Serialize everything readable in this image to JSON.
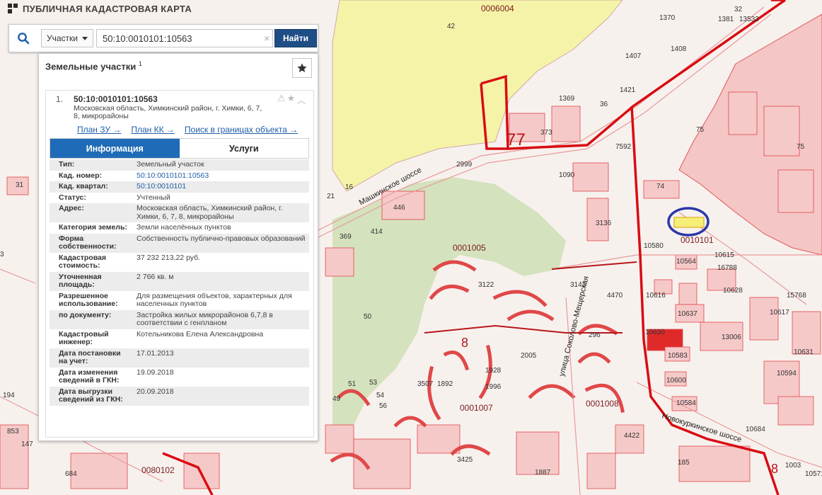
{
  "app": {
    "title": "ПУБЛИЧНАЯ КАДАСТРОВАЯ КАРТА"
  },
  "search": {
    "type_label": "Участки",
    "query": "50:10:0010101:10563",
    "clear_symbol": "×",
    "button_label": "Найти"
  },
  "panel": {
    "title": "Земельные участки",
    "count": "1",
    "result": {
      "number": "1.",
      "cad_number": "50:10:0010101:10563",
      "address": "Московская область, Химкинский район, г. Химки, 6, 7, 8, микрорайоны",
      "links": [
        "План ЗУ →",
        "План КК →",
        "Поиск в границах объекта →"
      ],
      "tabs": {
        "info": "Информация",
        "services": "Услуги"
      },
      "attributes": [
        {
          "key": "Тип:",
          "value": "Земельный участок"
        },
        {
          "key": "Кад. номер:",
          "value": "50:10:0010101:10563",
          "link": true
        },
        {
          "key": "Кад. квартал:",
          "value": "50:10:0010101",
          "link": true
        },
        {
          "key": "Статус:",
          "value": "Учтенный"
        },
        {
          "key": "Адрес:",
          "value": "Московская область, Химкинский район, г. Химки, 6, 7, 8, микрорайоны"
        },
        {
          "key": "Категория земель:",
          "value": "Земли населённых пунктов"
        },
        {
          "key": "Форма собственности:",
          "value": "Собственность публично-правовых образований"
        },
        {
          "key": "Кадастровая стоимость:",
          "value": "37 232 213,22 руб."
        },
        {
          "key": "Уточненная площадь:",
          "value": "2 766 кв. м"
        },
        {
          "key": "Разрешенное использование:",
          "value": "Для размещения объектов, характерных для населенных пунктов"
        },
        {
          "key": "по документу:",
          "value": "Застройка жилых микрорайонов 6,7,8 в соответствии с генпланом"
        },
        {
          "key": "Кадастровый инженер:",
          "value": "Котельникова Елена Александровна"
        },
        {
          "key": "Дата постановки на учет:",
          "value": "17.01.2013"
        },
        {
          "key": "Дата изменения сведений в ГКН:",
          "value": "19.09.2018"
        },
        {
          "key": "Дата выгрузки сведений из ГКН:",
          "value": "20.09.2018"
        }
      ]
    }
  },
  "map": {
    "labels": [
      {
        "text": "0006004",
        "kind": "label"
      },
      {
        "text": "42",
        "kind": "label"
      },
      {
        "text": "1370",
        "kind": "label"
      },
      {
        "text": "1381",
        "kind": "label"
      },
      {
        "text": "13533",
        "kind": "label"
      },
      {
        "text": "32",
        "kind": "label"
      },
      {
        "text": "1408",
        "kind": "label"
      },
      {
        "text": "1407",
        "kind": "label"
      },
      {
        "text": "1369",
        "kind": "label"
      },
      {
        "text": "1421",
        "kind": "label"
      },
      {
        "text": "36",
        "kind": "label"
      },
      {
        "text": "373",
        "kind": "label"
      },
      {
        "text": "75",
        "kind": "label"
      },
      {
        "text": "75",
        "kind": "label"
      },
      {
        "text": "2999",
        "kind": "label"
      },
      {
        "text": "7592",
        "kind": "label"
      },
      {
        "text": "1090",
        "kind": "label"
      },
      {
        "text": "74",
        "kind": "label"
      },
      {
        "text": "446",
        "kind": "label"
      },
      {
        "text": "414",
        "kind": "label"
      },
      {
        "text": "21",
        "kind": "label"
      },
      {
        "text": "16",
        "kind": "label"
      },
      {
        "text": "3136",
        "kind": "label"
      },
      {
        "text": "0010101",
        "kind": "label"
      },
      {
        "text": "10580",
        "kind": "label"
      },
      {
        "text": "10615",
        "kind": "label"
      },
      {
        "text": "10564",
        "kind": "label"
      },
      {
        "text": "16788",
        "kind": "label"
      },
      {
        "text": "0001005",
        "kind": "label"
      },
      {
        "text": "3122",
        "kind": "label"
      },
      {
        "text": "3143",
        "kind": "label"
      },
      {
        "text": "4470",
        "kind": "label"
      },
      {
        "text": "10616",
        "kind": "label"
      },
      {
        "text": "10628",
        "kind": "label"
      },
      {
        "text": "10637",
        "kind": "label"
      },
      {
        "text": "10617",
        "kind": "label"
      },
      {
        "text": "10630",
        "kind": "label"
      },
      {
        "text": "13006",
        "kind": "label"
      },
      {
        "text": "10583",
        "kind": "label"
      },
      {
        "text": "10631",
        "kind": "label"
      },
      {
        "text": "296",
        "kind": "label"
      },
      {
        "text": "50",
        "kind": "label"
      },
      {
        "text": "369",
        "kind": "label"
      },
      {
        "text": "1892",
        "kind": "label"
      },
      {
        "text": "1928",
        "kind": "label"
      },
      {
        "text": "2005",
        "kind": "label"
      },
      {
        "text": "1996",
        "kind": "label"
      },
      {
        "text": "3507",
        "kind": "label"
      },
      {
        "text": "0001007",
        "kind": "label"
      },
      {
        "text": "0001008",
        "kind": "label"
      },
      {
        "text": "10600",
        "kind": "label"
      },
      {
        "text": "10584",
        "kind": "label"
      },
      {
        "text": "10594",
        "kind": "label"
      },
      {
        "text": "10684",
        "kind": "label"
      },
      {
        "text": "3425",
        "kind": "label"
      },
      {
        "text": "4422",
        "kind": "label"
      },
      {
        "text": "185",
        "kind": "label"
      },
      {
        "text": "10571",
        "kind": "label"
      },
      {
        "text": "1003",
        "kind": "label"
      },
      {
        "text": "0080102",
        "kind": "label"
      },
      {
        "text": "684",
        "kind": "label"
      },
      {
        "text": "853",
        "kind": "label"
      },
      {
        "text": "147",
        "kind": "label"
      },
      {
        "text": "194",
        "kind": "label"
      },
      {
        "text": "31",
        "kind": "label"
      },
      {
        "text": "3",
        "kind": "label"
      },
      {
        "text": "49",
        "kind": "label"
      },
      {
        "text": "51",
        "kind": "label"
      },
      {
        "text": "53",
        "kind": "label"
      },
      {
        "text": "54",
        "kind": "label"
      },
      {
        "text": "56",
        "kind": "label"
      },
      {
        "text": "1887",
        "kind": "label"
      },
      {
        "text": "15768",
        "kind": "label"
      }
    ],
    "zone_77": "77",
    "zone_8a": "8",
    "zone_8b": "8",
    "road_1": "Машкинское шоссе",
    "road_2": "улица Соколово-Мещерская",
    "road_3": "Новокуркинское шоссе"
  },
  "colors": {
    "accent": "#1f4e86",
    "tab_active": "#1f6bb7",
    "parcel_fill": "#f6c9c9",
    "parcel_border": "#e03a3a",
    "boundary": "#d80c12",
    "forest": "#f5f3a8",
    "green": "#cfe0b8",
    "highlight_circle": "#2c37a8",
    "selected_parcel": "#f5ef7a"
  },
  "icons": {
    "logo": "pkk-logo-icon",
    "search": "search-icon",
    "favorite": "star-icon",
    "warning": "warning-icon",
    "collapse": "chevron-up-icon"
  }
}
